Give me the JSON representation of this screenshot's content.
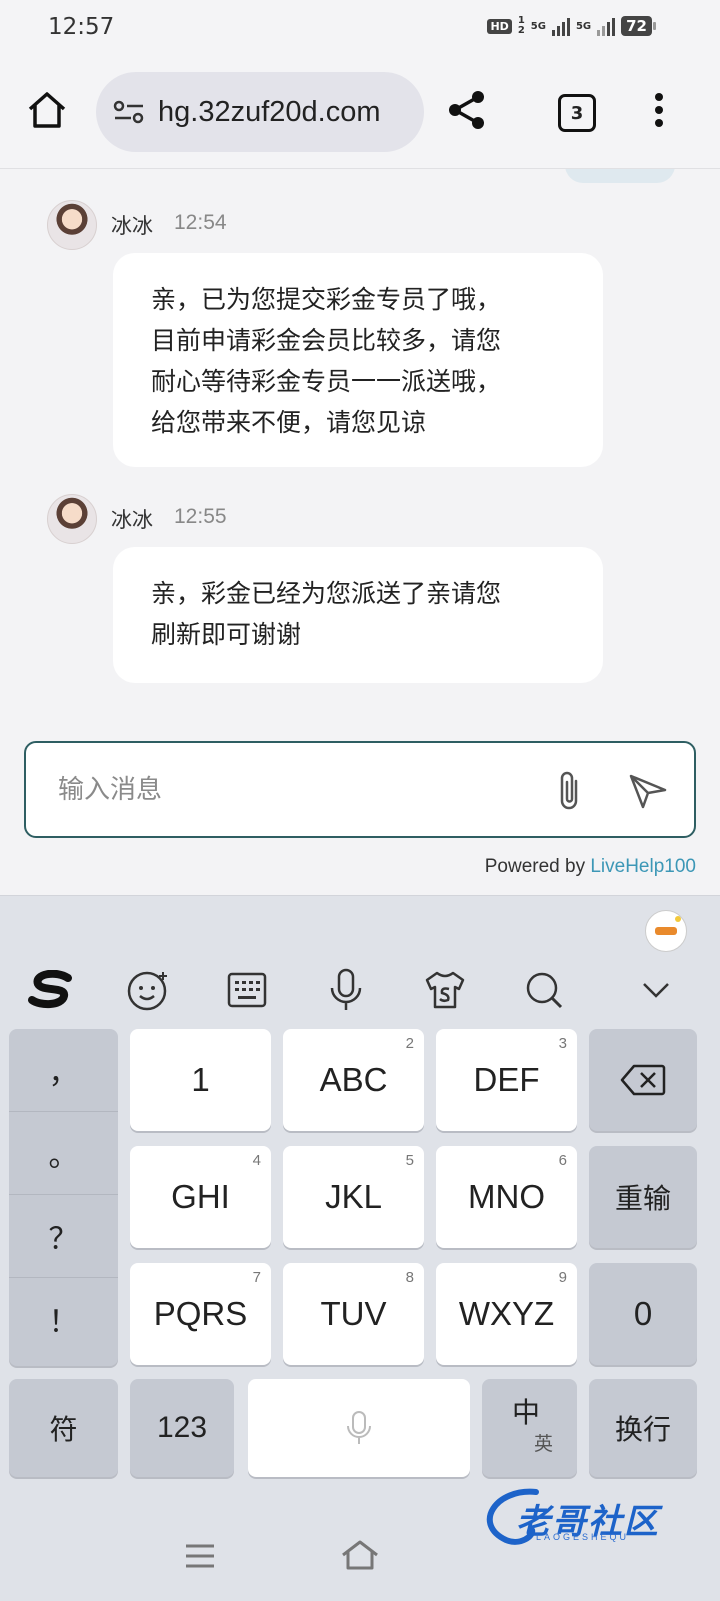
{
  "status_bar": {
    "time": "12:57",
    "hd": "HD",
    "hd_sub_1": "1",
    "hd_sub_2": "2",
    "network_1": "5G",
    "network_2": "5G",
    "battery": "72"
  },
  "browser": {
    "url": "hg.32zuf20d.com",
    "tab_count": "3",
    "icons": [
      "home-icon",
      "site-settings-icon",
      "share-icon",
      "more-icon"
    ]
  },
  "chat": {
    "messages": [
      {
        "sender": "冰冰",
        "time": "12:54",
        "lines": [
          "亲，已为您提交彩金专员了哦，",
          "目前申请彩金会员比较多，请您",
          "耐心等待彩金专员一一派送哦，",
          "给您带来不便，请您见谅"
        ]
      },
      {
        "sender": "冰冰",
        "time": "12:55",
        "lines": [
          "亲，彩金已经为您派送了亲请您",
          "刷新即可谢谢"
        ]
      }
    ],
    "input_placeholder": "输入消息",
    "powered_prefix": "Powered by ",
    "powered_brand": "LiveHelp100"
  },
  "keyboard": {
    "toolbar_icons": [
      "sogou-logo-icon",
      "emoji-icon",
      "keyboard-icon",
      "microphone-icon",
      "skin-icon",
      "search-icon",
      "collapse-icon"
    ],
    "punctuation": [
      "，",
      "。",
      "？",
      "！"
    ],
    "keys": {
      "k1": "1",
      "k2": "ABC",
      "k2_sub": "2",
      "k3": "DEF",
      "k3_sub": "3",
      "k4": "GHI",
      "k4_sub": "4",
      "k5": "JKL",
      "k5_sub": "5",
      "k6": "MNO",
      "k6_sub": "6",
      "k7": "PQRS",
      "k7_sub": "7",
      "k8": "TUV",
      "k8_sub": "8",
      "k9": "WXYZ",
      "k9_sub": "9",
      "reenter": "重输",
      "zero": "0",
      "symbols": "符",
      "numbers": "123",
      "lang_main": "中",
      "lang_sub": "英",
      "enter": "换行"
    }
  },
  "watermark": {
    "text": "老哥社区",
    "sub": "LAOGESHEQU"
  },
  "colors": {
    "composer_border": "#2e5e62",
    "brand_link": "#3c97b6",
    "watermark": "#1d63c9"
  }
}
